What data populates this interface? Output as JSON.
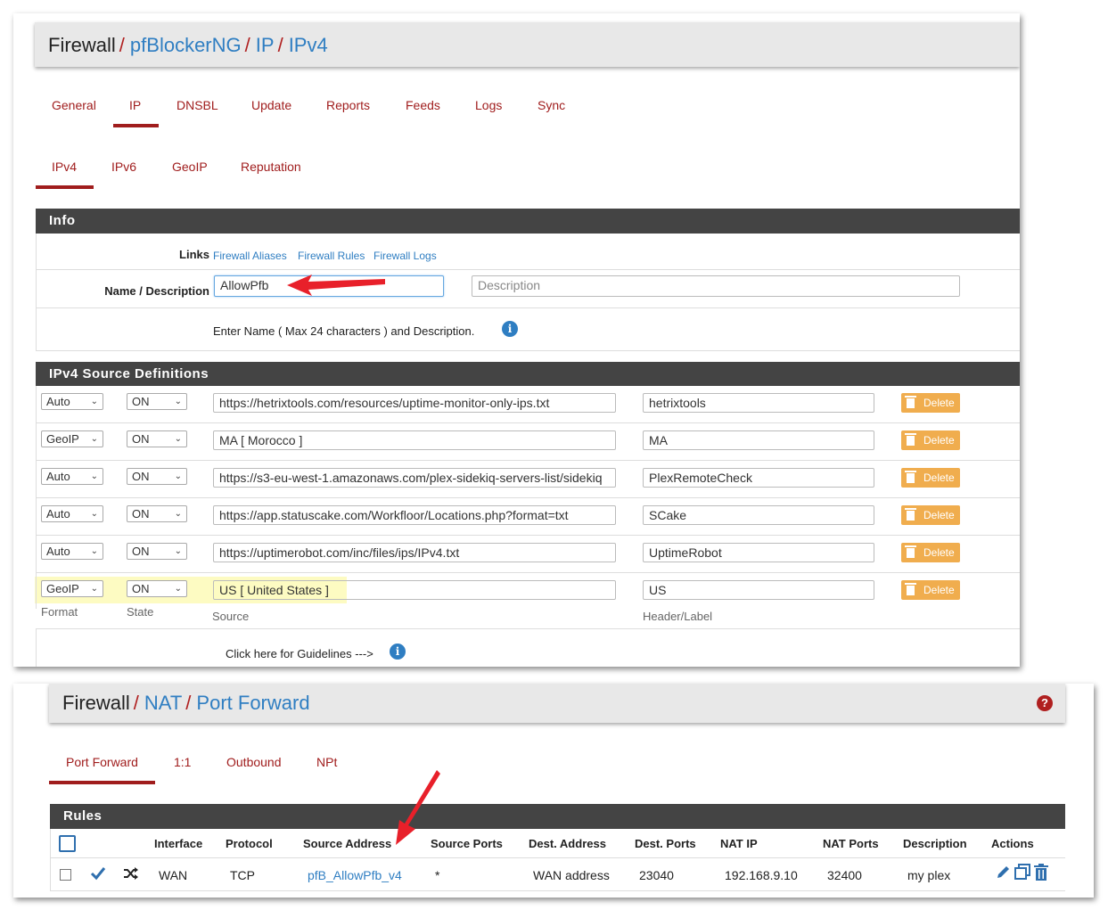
{
  "pfblocker": {
    "breadcrumb": {
      "first": "Firewall",
      "sep": "/",
      "b1": "pfBlockerNG",
      "b2": "IP",
      "b3": "IPv4"
    },
    "tabs": [
      "General",
      "IP",
      "DNSBL",
      "Update",
      "Reports",
      "Feeds",
      "Logs",
      "Sync"
    ],
    "active_tab": "IP",
    "subtabs": [
      "IPv4",
      "IPv6",
      "GeoIP",
      "Reputation"
    ],
    "active_subtab": "IPv4",
    "info": {
      "title": "Info",
      "links_label": "Links",
      "links": [
        "Firewall Aliases",
        "Firewall Rules",
        "Firewall Logs"
      ],
      "name_label": "Name / Description",
      "name_value": "AllowPfb",
      "description_placeholder": "Description",
      "help_text": "Enter Name ( Max 24 characters ) and Description."
    },
    "source": {
      "title": "IPv4 Source Definitions",
      "rows": [
        {
          "format": "Auto",
          "state": "ON",
          "source": "https://hetrixtools.com/resources/uptime-monitor-only-ips.txt",
          "header": "hetrixtools"
        },
        {
          "format": "GeoIP",
          "state": "ON",
          "source": "MA [ Morocco ]",
          "header": "MA"
        },
        {
          "format": "Auto",
          "state": "ON",
          "source": "https://s3-eu-west-1.amazonaws.com/plex-sidekiq-servers-list/sidekiq",
          "header": "PlexRemoteCheck"
        },
        {
          "format": "Auto",
          "state": "ON",
          "source": "https://app.statuscake.com/Workfloor/Locations.php?format=txt",
          "header": "SCake"
        },
        {
          "format": "Auto",
          "state": "ON",
          "source": "https://uptimerobot.com/inc/files/ips/IPv4.txt",
          "header": "UptimeRobot"
        },
        {
          "format": "GeoIP",
          "state": "ON",
          "source": "US [ United States ]",
          "header": "US"
        }
      ],
      "delete_label": "Delete",
      "format_hint": "Format",
      "state_hint": "State",
      "source_hint": "Source",
      "header_hint": "Header/Label",
      "guidelines": "Click here for Guidelines --->"
    }
  },
  "nat": {
    "breadcrumb": {
      "first": "Firewall",
      "sep": "/",
      "b1": "NAT",
      "b2": "Port Forward"
    },
    "tabs": [
      "Port Forward",
      "1:1",
      "Outbound",
      "NPt"
    ],
    "active_tab": "Port Forward",
    "rules_title": "Rules",
    "columns": [
      "Interface",
      "Protocol",
      "Source Address",
      "Source Ports",
      "Dest. Address",
      "Dest. Ports",
      "NAT IP",
      "NAT Ports",
      "Description",
      "Actions"
    ],
    "row": {
      "interface": "WAN",
      "protocol": "TCP",
      "source_address": "pfB_AllowPfb_v4",
      "source_ports": "*",
      "dest_address": "WAN address",
      "dest_ports": "23040",
      "nat_ip": "192.168.9.10",
      "nat_ports": "32400",
      "description": "my plex"
    }
  },
  "colors": {
    "accent_red": "#a01d1d",
    "link_blue": "#2f7ec2",
    "header_dark": "#444444",
    "delete_orange": "#f0ad4e",
    "highlight": "#fdfbc2"
  }
}
